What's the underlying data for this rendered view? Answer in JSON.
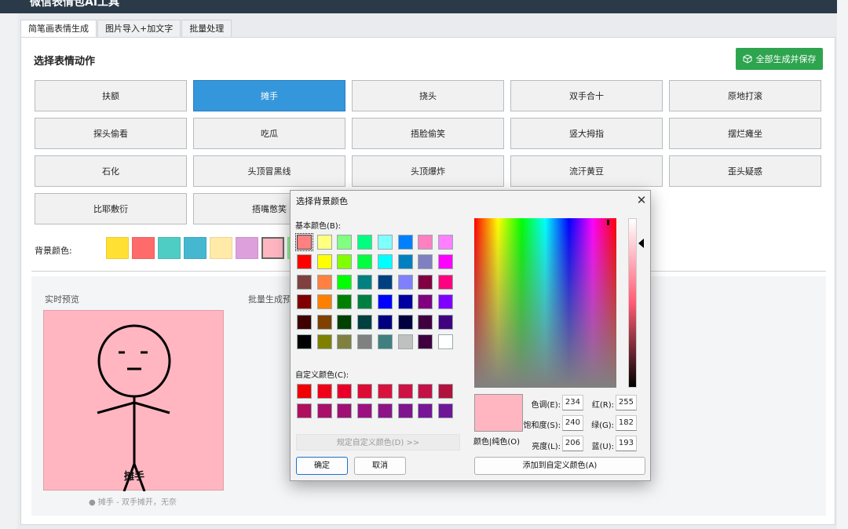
{
  "app": {
    "title": "微信表情包AI工具",
    "tabs": [
      "简笔画表情生成",
      "图片导入+加文字",
      "批量处理"
    ]
  },
  "section_title": "选择表情动作",
  "save_all_label": "全部生成并保存",
  "actions": [
    "扶额",
    "摊手",
    "挠头",
    "双手合十",
    "原地打滚",
    "探头偷看",
    "吃瓜",
    "捂脸偷笑",
    "竖大拇指",
    "摆烂瘫坐",
    "石化",
    "头顶冒黑线",
    "头顶爆炸",
    "流汗黄豆",
    "歪头疑惑",
    "比耶敷衍",
    "捂嘴憋笑"
  ],
  "selected_action": "摊手",
  "bg_label": "背景颜色:",
  "bg_swatches": [
    "#FFE033",
    "#FF6B6B",
    "#4ECDC4",
    "#45B7D1",
    "#FFEAA7",
    "#DDA0DD",
    "#FFB6C1",
    "#98FB98"
  ],
  "preview": {
    "live_label": "实时预览",
    "batch_label": "批量生成预",
    "caption": "摊手",
    "status": "● 摊手 - 双手摊开，无奈"
  },
  "dialog": {
    "title": "选择背景颜色",
    "basic_label": "基本颜色(B):",
    "custom_label": "自定义颜色(C):",
    "define_custom_label": "规定自定义颜色(D) >>",
    "ok_label": "确定",
    "cancel_label": "取消",
    "color_solid_label": "颜色|纯色(O)",
    "add_custom_label": "添加到自定义颜色(A)",
    "fields": {
      "hue_label": "色调(E):",
      "hue": "234",
      "sat_label": "饱和度(S):",
      "sat": "240",
      "lum_label": "亮度(L):",
      "lum": "206",
      "red_label": "红(R):",
      "red": "255",
      "green_label": "绿(G):",
      "green": "182",
      "blue_label": "蓝(U):",
      "blue": "193"
    },
    "basic_colors": [
      "#FF8080",
      "#FFFF80",
      "#80FF80",
      "#00FF80",
      "#80FFFF",
      "#0080FF",
      "#FF80C0",
      "#FF80FF",
      "#FF0000",
      "#FFFF00",
      "#80FF00",
      "#00FF40",
      "#00FFFF",
      "#0080C0",
      "#8080C0",
      "#FF00FF",
      "#804040",
      "#FF8040",
      "#00FF00",
      "#008080",
      "#004080",
      "#8080FF",
      "#800040",
      "#FF0080",
      "#800000",
      "#FF8000",
      "#008000",
      "#008040",
      "#0000FF",
      "#0000A0",
      "#800080",
      "#8000FF",
      "#400000",
      "#804000",
      "#004000",
      "#004040",
      "#000080",
      "#000040",
      "#400040",
      "#400080",
      "#000000",
      "#808000",
      "#808040",
      "#808080",
      "#408080",
      "#C0C0C0",
      "#400040",
      "#FFFFFF"
    ],
    "custom_colors": [
      "#F00000",
      "#F00018",
      "#E8002A",
      "#DC0C34",
      "#D8123C",
      "#CF1244",
      "#C31248",
      "#B1123E",
      "#AF105E",
      "#A8106A",
      "#A01074",
      "#9C1080",
      "#8D1486",
      "#80148E",
      "#781496",
      "#6E1898"
    ]
  }
}
